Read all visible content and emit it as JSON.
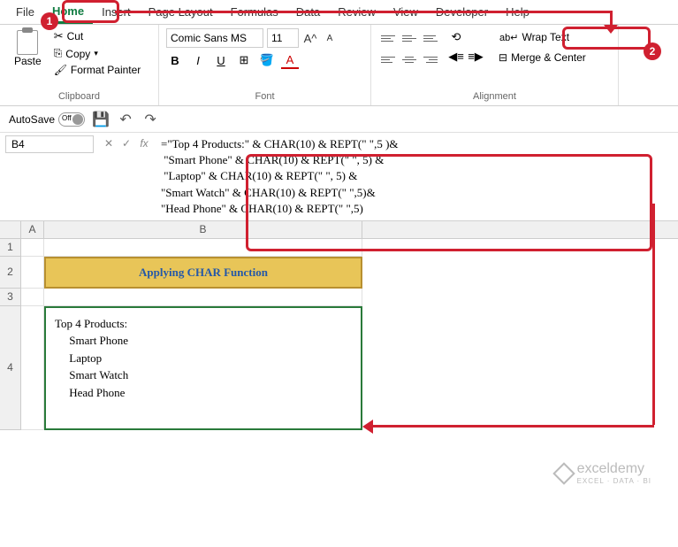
{
  "tabs": {
    "file": "File",
    "home": "Home",
    "insert": "Insert",
    "page_layout": "Page Layout",
    "formulas": "Formulas",
    "data": "Data",
    "review": "Review",
    "view": "View",
    "developer": "Developer",
    "help": "Help"
  },
  "ribbon": {
    "clipboard": {
      "paste": "Paste",
      "cut": "Cut",
      "copy": "Copy",
      "format_painter": "Format Painter",
      "label": "Clipboard"
    },
    "font": {
      "name": "Comic Sans MS",
      "size": "11",
      "label": "Font"
    },
    "alignment": {
      "wrap_text": "Wrap Text",
      "merge_center": "Merge & Center",
      "label": "Alignment"
    }
  },
  "qat": {
    "autosave": "AutoSave",
    "off": "Off"
  },
  "name_box": "B4",
  "formula": "=\"Top 4 Products:\" & CHAR(10) & REPT(\" \",5 )&\n \"Smart Phone\" & CHAR(10) & REPT(\" \", 5) &\n \"Laptop\" & CHAR(10) & REPT(\" \", 5) &\n\"Smart Watch\" & CHAR(10) & REPT(\" \",5)&\n\"Head Phone\" & CHAR(10) & REPT(\" \",5)",
  "sheet": {
    "cols": {
      "A": "A",
      "B": "B"
    },
    "title_cell": "Applying CHAR Function",
    "content_cell": "Top 4 Products:\n     Smart Phone\n     Laptop\n     Smart Watch\n     Head Phone"
  },
  "watermark": {
    "text": "exceldemy",
    "sub": "EXCEL · DATA · BI"
  },
  "badges": {
    "one": "1",
    "two": "2"
  }
}
